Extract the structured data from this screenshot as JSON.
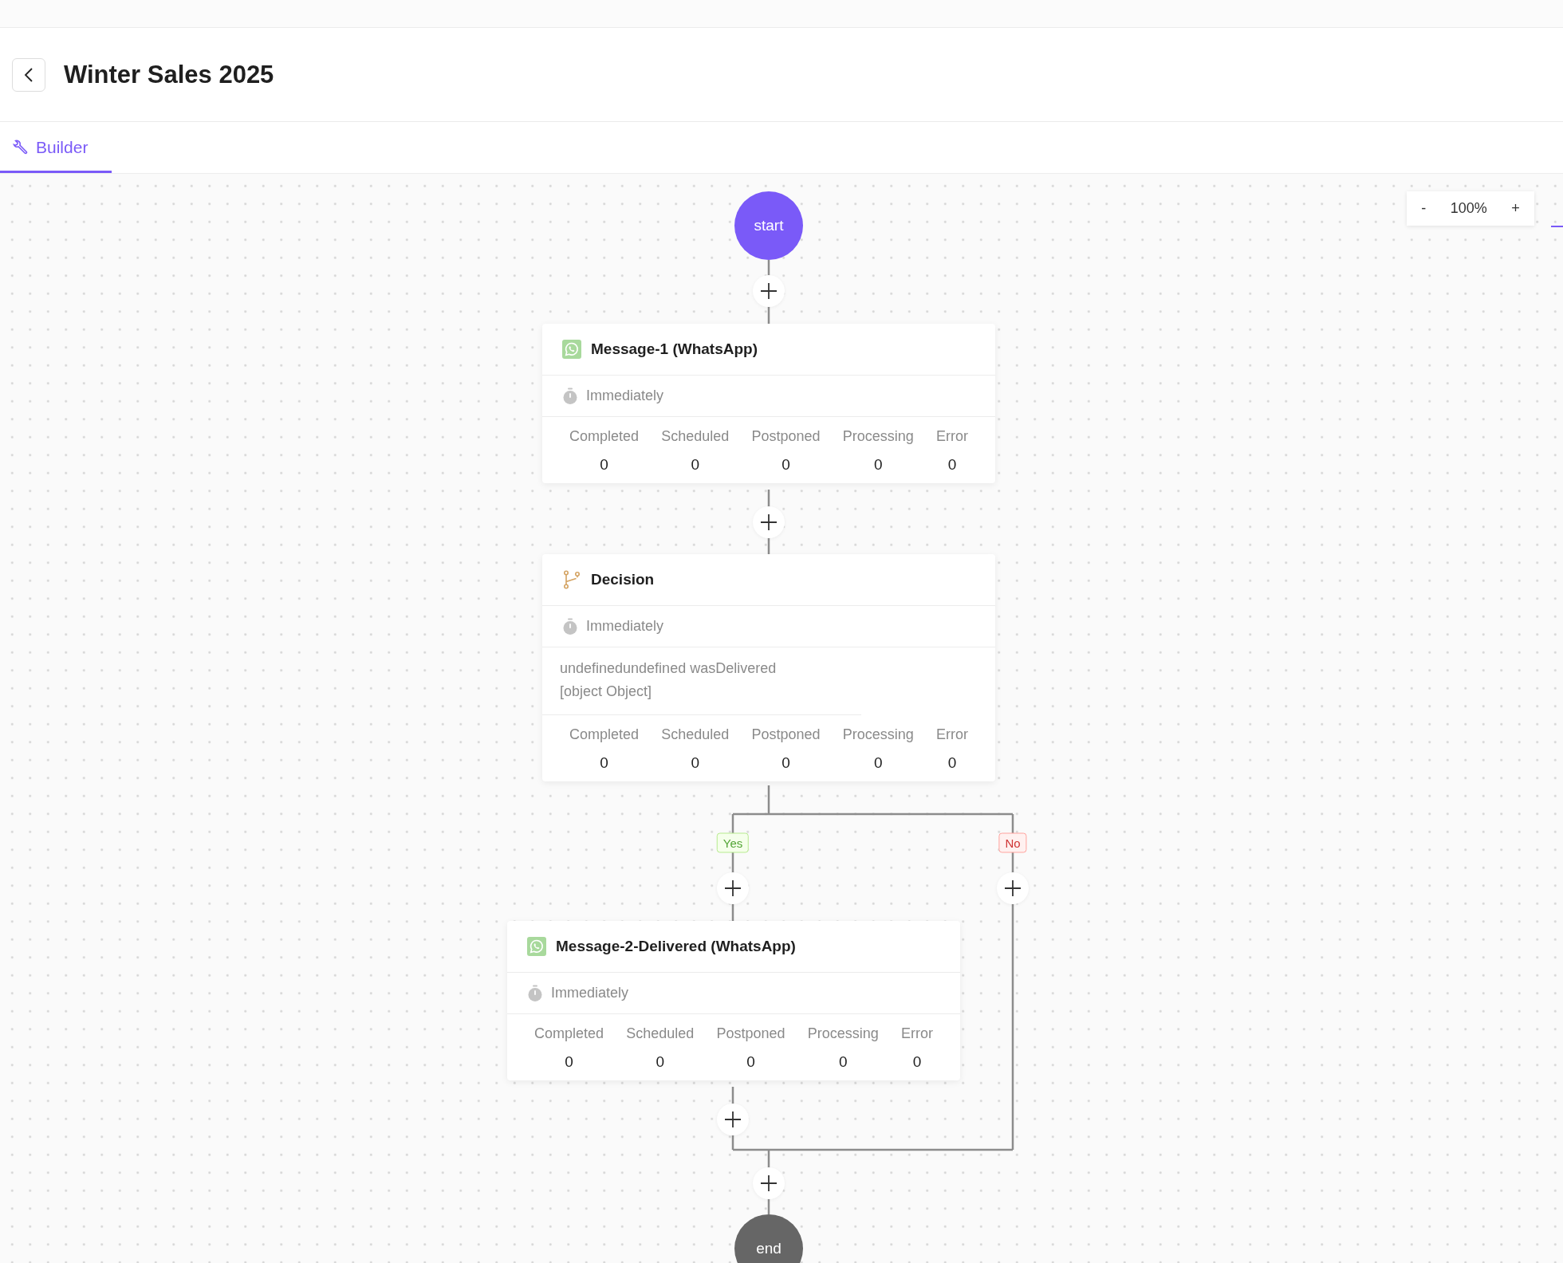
{
  "header": {
    "title": "Winter Sales 2025"
  },
  "tabs": [
    {
      "label": "Builder",
      "selected": true
    }
  ],
  "zoom": {
    "minus": "-",
    "value": "100%",
    "plus": "+"
  },
  "flow": {
    "start": "start",
    "end": "end",
    "nodes": [
      {
        "kind": "message",
        "title": "Message-1 (WhatsApp)",
        "delay": "Immediately",
        "stats": [
          {
            "label": "Completed",
            "value": "0"
          },
          {
            "label": "Scheduled",
            "value": "0"
          },
          {
            "label": "Postponed",
            "value": "0"
          },
          {
            "label": "Processing",
            "value": "0"
          },
          {
            "label": "Error",
            "value": "0"
          }
        ]
      },
      {
        "kind": "decision",
        "title": "Decision",
        "delay": "Immediately",
        "condition": [
          "undefinedundefined wasDelivered",
          "[object Object]"
        ],
        "stats": [
          {
            "label": "Completed",
            "value": "0"
          },
          {
            "label": "Scheduled",
            "value": "0"
          },
          {
            "label": "Postponed",
            "value": "0"
          },
          {
            "label": "Processing",
            "value": "0"
          },
          {
            "label": "Error",
            "value": "0"
          }
        ]
      },
      {
        "kind": "message",
        "title": "Message-2-Delivered (WhatsApp)",
        "delay": "Immediately",
        "stats": [
          {
            "label": "Completed",
            "value": "0"
          },
          {
            "label": "Scheduled",
            "value": "0"
          },
          {
            "label": "Postponed",
            "value": "0"
          },
          {
            "label": "Processing",
            "value": "0"
          },
          {
            "label": "Error",
            "value": "0"
          }
        ]
      }
    ],
    "branches": [
      {
        "kind": "yes",
        "label": "Yes"
      },
      {
        "kind": "no",
        "label": "No"
      }
    ]
  }
}
